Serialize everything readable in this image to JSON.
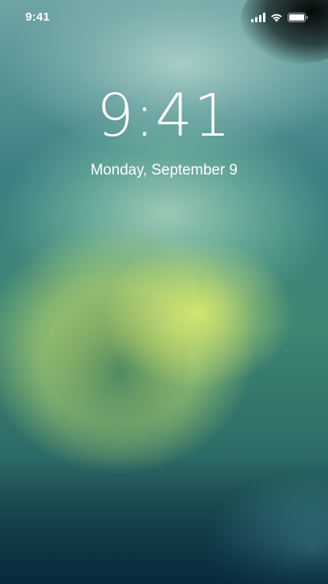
{
  "status_bar": {
    "time": "9:41",
    "icons": [
      "cellular-signal-icon",
      "wifi-icon",
      "battery-icon"
    ]
  },
  "lock_screen": {
    "clock": "9:41",
    "date": "Monday, September 9"
  },
  "colors": {
    "text": "#ffffff",
    "wallpaper_top": "#6fa4a4",
    "wallpaper_green": "#c6d264",
    "wallpaper_bottom": "#0f3b4a"
  }
}
